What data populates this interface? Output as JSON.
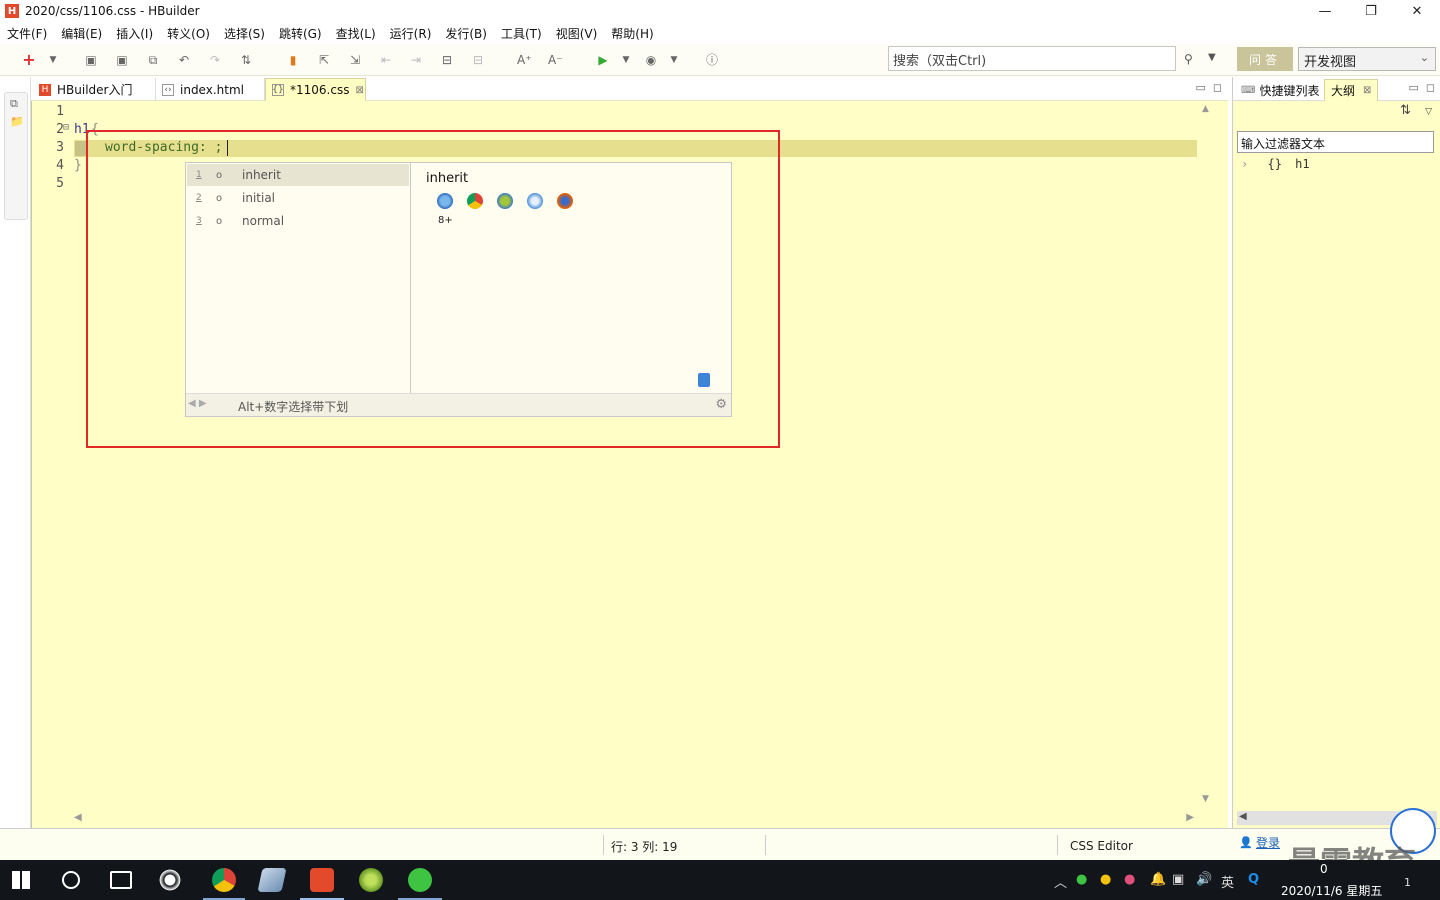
{
  "window": {
    "title": "2020/css/1106.css  -  HBuilder",
    "app_icon": "H",
    "controls": [
      "—",
      "❐",
      "✕"
    ]
  },
  "menu": [
    "文件(F)",
    "编辑(E)",
    "插入(I)",
    "转义(O)",
    "选择(S)",
    "跳转(G)",
    "查找(L)",
    "运行(R)",
    "发行(B)",
    "工具(T)",
    "视图(V)",
    "帮助(H)"
  ],
  "toolbar": {
    "search_placeholder": "搜索（双击Ctrl)",
    "qa_label": "问答",
    "view_select_value": "开发视图"
  },
  "editor": {
    "tabs": [
      {
        "label": "HBuilder入门",
        "icon": "hbuilder-icon"
      },
      {
        "label": "index.html",
        "icon": "html-file-icon"
      },
      {
        "label": "*1106.css",
        "icon": "css-file-icon",
        "active": true
      }
    ],
    "line_numbers": [
      "1",
      "2",
      "3",
      "4",
      "5"
    ],
    "code": {
      "line2_selector": "h1",
      "line2_brace": "{",
      "line3": "word-spacing: ;",
      "line4": "}"
    }
  },
  "autocomplete": {
    "items": [
      {
        "num": "1",
        "label": "inherit",
        "selected": true
      },
      {
        "num": "2",
        "label": "initial"
      },
      {
        "num": "3",
        "label": "normal"
      }
    ],
    "detail_title": "inherit",
    "browsers": [
      "ie-icon",
      "chrome-icon",
      "android-icon",
      "safari-icon",
      "firefox-icon"
    ],
    "ie_version": "8+",
    "footer_hint": "Alt+数字选择带下划"
  },
  "outline_panel": {
    "tabs": [
      "快捷键列表",
      "大纲"
    ],
    "active_tab": "大纲",
    "filter_value": "输入过滤器文本",
    "tree": [
      {
        "icon": "{}",
        "label": "h1"
      }
    ]
  },
  "status": {
    "position": "行: 3 列: 19",
    "editor_type": "CSS Editor",
    "login": "登录"
  },
  "watermark": "最需教育",
  "taskbar": {
    "date": "2020/11/6 星期五",
    "time": "0",
    "ime": "英",
    "notification_count": "1"
  },
  "colors": {
    "editor_bg": "#fffec7",
    "line_highlight": "#e6df8e",
    "annotation_red": "#e02828",
    "taskbar_bg": "#121519"
  }
}
